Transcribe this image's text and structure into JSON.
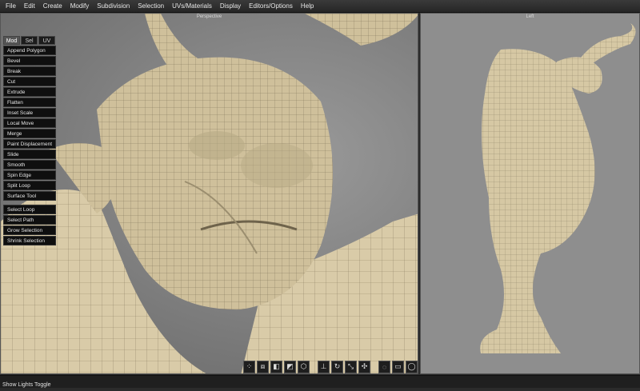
{
  "menubar": {
    "items": [
      "File",
      "Edit",
      "Create",
      "Modify",
      "Subdivision",
      "Selection",
      "UVs/Materials",
      "Display",
      "Editors/Options",
      "Help"
    ]
  },
  "viewports": {
    "perspective_label": "Perspective",
    "left_label": "Left"
  },
  "toolpanel": {
    "tabs": [
      "Mod",
      "Sel",
      "UV"
    ],
    "active_tab": "Mod",
    "tools": [
      "Append Polygon",
      "Bevel",
      "Break",
      "Cut",
      "Extrude",
      "Flatten",
      "Inset Scale",
      "Local Move",
      "Merge",
      "Paint Displacement",
      "Slide",
      "Smooth",
      "Spin Edge",
      "Split Loop",
      "Surface Tool"
    ],
    "selection_tools": [
      "Select Loop",
      "Select Path",
      "Grow Selection",
      "Shrink Selection"
    ]
  },
  "bottom_toolbar": {
    "icons": [
      "vertex-mode-icon",
      "edge-mode-icon",
      "face-mode-icon",
      "object-mode-icon",
      "sphere-mode-icon",
      "move-axis-icon",
      "rotate-axis-icon",
      "scale-axis-icon",
      "universal-axis-icon",
      "lasso-select-icon",
      "box-select-icon",
      "paint-select-icon"
    ]
  },
  "status": {
    "message": "Show Lights Toggle"
  }
}
